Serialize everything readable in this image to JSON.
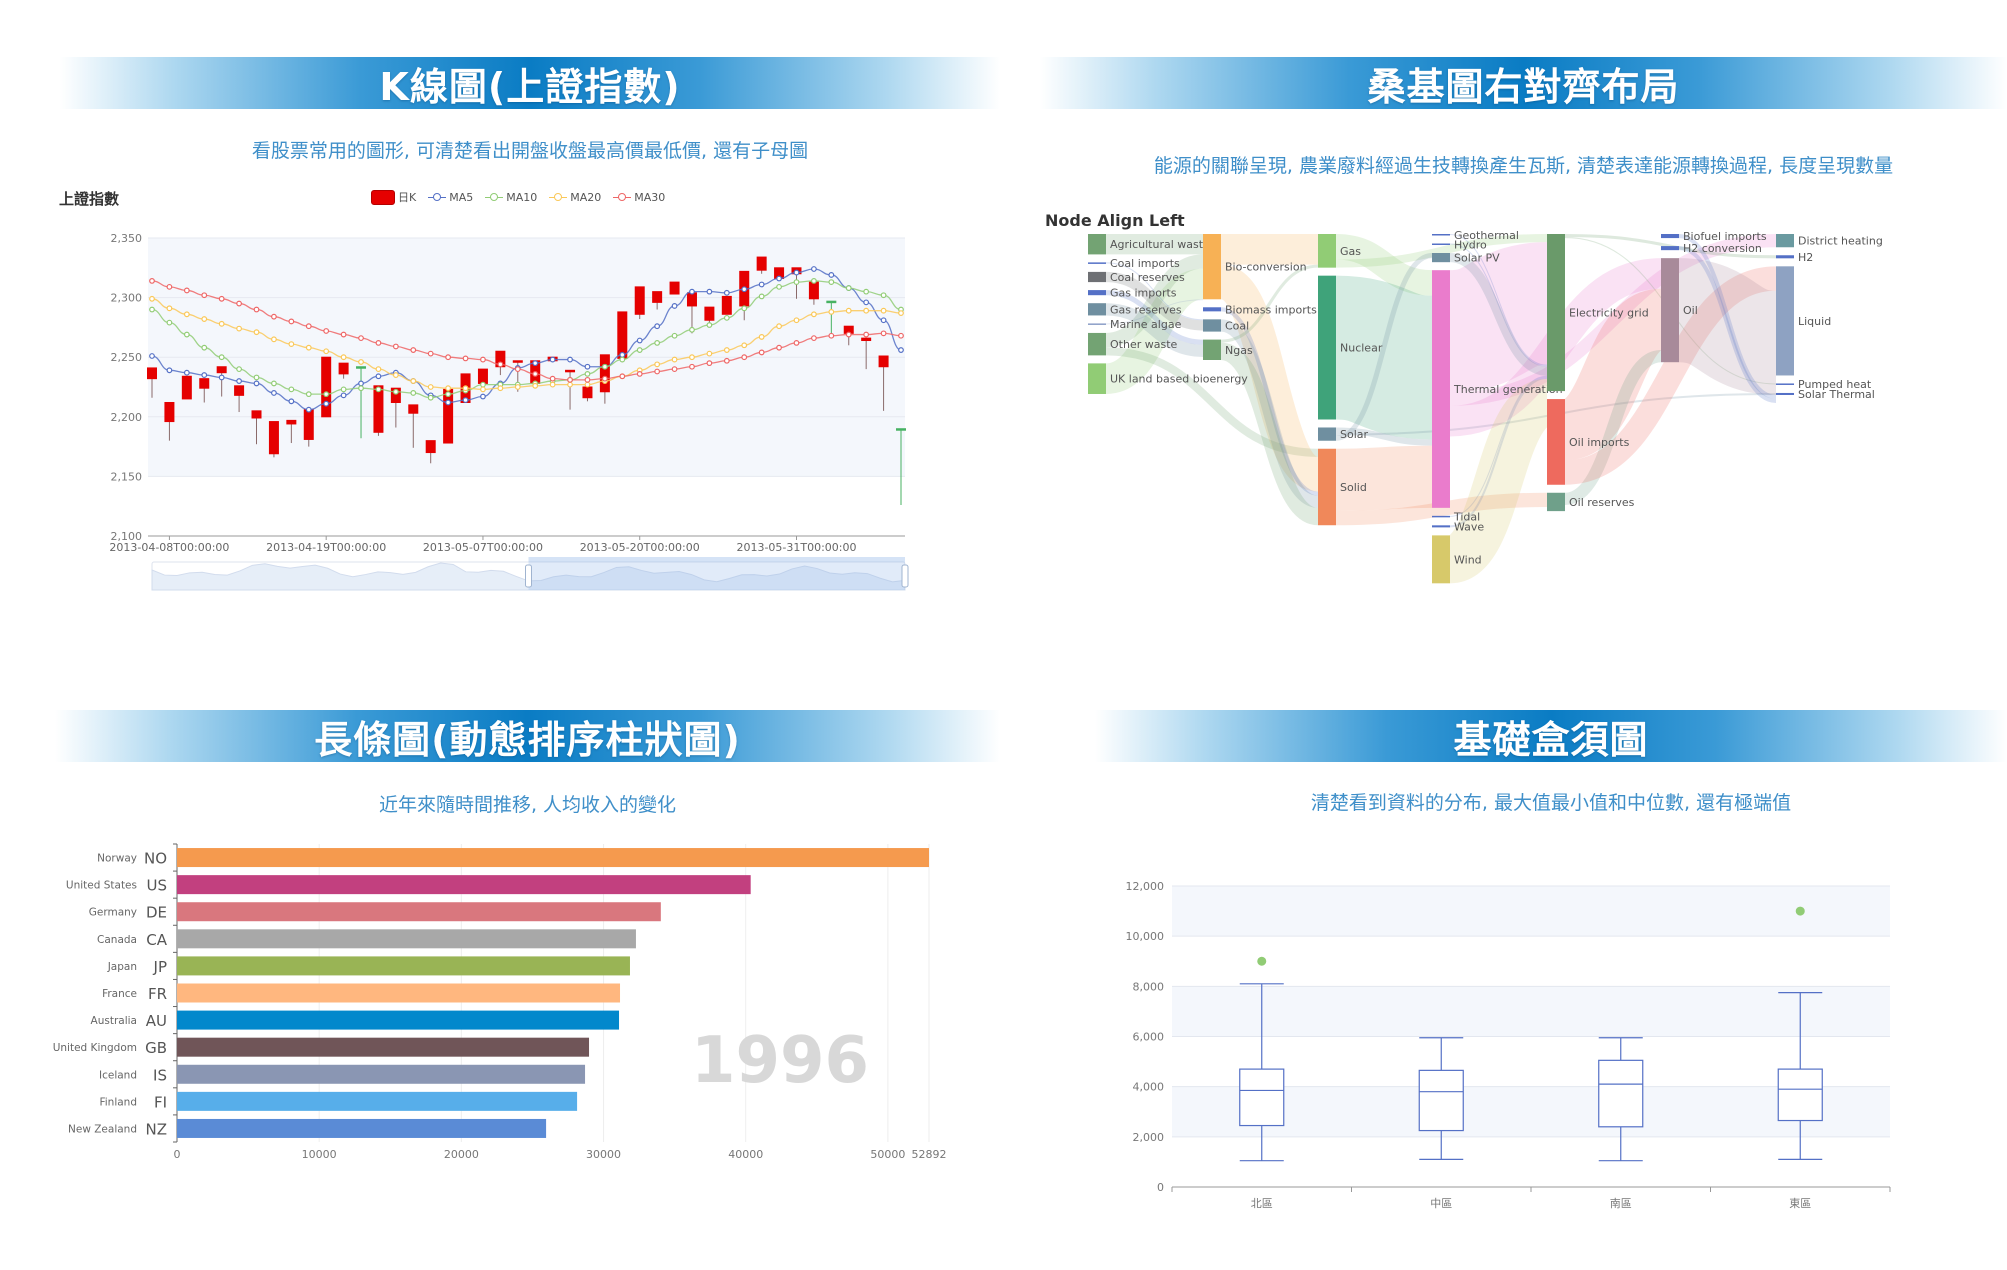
{
  "panels": {
    "kline": {
      "banner": "K線圖(上證指數)",
      "subtitle": "看股票常用的圖形, 可清楚看出開盤收盤最高價最低價, 還有子母圖"
    },
    "sankey": {
      "banner": "桑基圖右對齊布局",
      "subtitle": "能源的關聯呈現, 農業廢料經過生技轉換產生瓦斯, 清楚表達能源轉換過程, 長度呈現數量"
    },
    "bar": {
      "banner": "長條圖(動態排序柱狀圖)",
      "subtitle": "近年來隨時間推移, 人均收入的變化"
    },
    "boxplot": {
      "banner": "基礎盒須圖",
      "subtitle": "清楚看到資料的分布, 最大值最小值和中位數, 還有極端值"
    }
  },
  "chart_data": [
    {
      "type": "candlestick",
      "title": "上證指數",
      "legend": [
        "日K",
        "MA5",
        "MA10",
        "MA20",
        "MA30"
      ],
      "legend_position": "top-center",
      "colors": {
        "up": "#e50000",
        "doji": "#47b262",
        "MA5": "#5470c6",
        "MA10": "#91cc75",
        "MA20": "#fac858",
        "MA30": "#ee6666"
      },
      "ylim": [
        2100,
        2350
      ],
      "yticks": [
        2100,
        2150,
        2200,
        2250,
        2300,
        2350
      ],
      "ytick_labels": [
        "2,100",
        "2,150",
        "2,200",
        "2,250",
        "2,300",
        "2,350"
      ],
      "xtick_labels": [
        "2013-04-08T00:00:00",
        "2013-04-19T00:00:00",
        "2013-05-07T00:00:00",
        "2013-05-20T00:00:00",
        "2013-05-31T00:00:00"
      ],
      "xtick_indices": [
        1,
        10,
        19,
        28,
        37
      ],
      "datazoom_range_percent": [
        50,
        100
      ],
      "ohlc": [
        [
          2232,
          2241,
          2216,
          2241
        ],
        [
          2196,
          2212,
          2180,
          2212
        ],
        [
          2215,
          2234,
          2215,
          2234
        ],
        [
          2224,
          2232,
          2212,
          2232
        ],
        [
          2237,
          2242,
          2217,
          2242
        ],
        [
          2218,
          2226,
          2204,
          2226
        ],
        [
          2199,
          2205,
          2177,
          2205
        ],
        [
          2169,
          2196,
          2166,
          2196
        ],
        [
          2194,
          2197,
          2178,
          2197
        ],
        [
          2181,
          2206,
          2175,
          2206
        ],
        [
          2200,
          2250,
          2200,
          2250
        ],
        [
          2236,
          2245,
          2232,
          2245
        ],
        [
          2242,
          2242,
          2182,
          2242
        ],
        [
          2187,
          2226,
          2184,
          2226
        ],
        [
          2212,
          2224,
          2191,
          2224
        ],
        [
          2203,
          2210,
          2174,
          2210
        ],
        [
          2170,
          2180,
          2161,
          2180
        ],
        [
          2178,
          2223,
          2178,
          2223
        ],
        [
          2212,
          2236,
          2212,
          2236
        ],
        [
          2228,
          2240,
          2228,
          2240
        ],
        [
          2242,
          2255,
          2235,
          2255
        ],
        [
          2246,
          2247,
          2221,
          2247
        ],
        [
          2228,
          2247,
          2228,
          2247
        ],
        [
          2247,
          2250,
          2247,
          2250
        ],
        [
          2238,
          2239,
          2206,
          2239
        ],
        [
          2216,
          2225,
          2213,
          2225
        ],
        [
          2221,
          2252,
          2211,
          2252
        ],
        [
          2249,
          2288,
          2249,
          2288
        ],
        [
          2286,
          2309,
          2282,
          2309
        ],
        [
          2296,
          2305,
          2290,
          2305
        ],
        [
          2303,
          2313,
          2303,
          2313
        ],
        [
          2293,
          2304,
          2270,
          2304
        ],
        [
          2281,
          2292,
          2275,
          2292
        ],
        [
          2286,
          2301,
          2286,
          2301
        ],
        [
          2293,
          2322,
          2281,
          2322
        ],
        [
          2323,
          2334,
          2320,
          2334
        ],
        [
          2316,
          2325,
          2316,
          2325
        ],
        [
          2320,
          2325,
          2299,
          2325
        ],
        [
          2299,
          2313,
          2294,
          2313
        ],
        [
          2297,
          2297,
          2270,
          2297
        ],
        [
          2270,
          2276,
          2260,
          2276
        ],
        [
          2264,
          2266,
          2240,
          2266
        ],
        [
          2242,
          2251,
          2205,
          2251
        ],
        [
          2190,
          2190,
          2126,
          2190
        ]
      ],
      "ma": {
        "MA5": [
          2251,
          2239,
          2237,
          2235,
          2233,
          2230,
          2228,
          2220,
          2213,
          2206,
          2211,
          2218,
          2228,
          2234,
          2237,
          2230,
          2218,
          2212,
          2214,
          2217,
          2228,
          2241,
          2245,
          2248,
          2248,
          2242,
          2242,
          2252,
          2264,
          2276,
          2293,
          2305,
          2305,
          2304,
          2307,
          2311,
          2316,
          2321,
          2324,
          2319,
          2308,
          2296,
          2281,
          2256
        ],
        "MA10": [
          2290,
          2279,
          2269,
          2258,
          2250,
          2240,
          2233,
          2228,
          2223,
          2219,
          2219,
          2223,
          2224,
          2223,
          2221,
          2220,
          2216,
          2219,
          2222,
          2227,
          2227,
          2227,
          2228,
          2230,
          2231,
          2236,
          2242,
          2248,
          2256,
          2262,
          2268,
          2273,
          2277,
          2283,
          2291,
          2301,
          2309,
          2313,
          2314,
          2313,
          2308,
          2305,
          2302,
          2290
        ],
        "MA20": [
          2299,
          2291,
          2286,
          2282,
          2278,
          2274,
          2271,
          2265,
          2261,
          2258,
          2255,
          2250,
          2246,
          2240,
          2235,
          2230,
          2225,
          2224,
          2224,
          2223,
          2224,
          2225,
          2226,
          2227,
          2227,
          2227,
          2230,
          2234,
          2239,
          2244,
          2248,
          2250,
          2253,
          2256,
          2260,
          2267,
          2276,
          2281,
          2286,
          2288,
          2289,
          2289,
          2289,
          2287
        ],
        "MA30": [
          2314,
          2309,
          2306,
          2302,
          2299,
          2295,
          2290,
          2284,
          2280,
          2276,
          2272,
          2269,
          2266,
          2262,
          2259,
          2256,
          2253,
          2250,
          2249,
          2248,
          2244,
          2240,
          2236,
          2232,
          2231,
          2231,
          2232,
          2234,
          2236,
          2238,
          2240,
          2242,
          2245,
          2247,
          2250,
          2254,
          2258,
          2262,
          2266,
          2268,
          2269,
          2269,
          2270,
          2268
        ]
      }
    },
    {
      "type": "sankey",
      "title": "Node Align Left",
      "node_align": "left",
      "columns": [
        [
          {
            "name": "Agricultural waste",
            "value": 20,
            "color": "#73a373"
          },
          {
            "name": "Coal imports",
            "value": 1,
            "color": "#5470c6"
          },
          {
            "name": "Coal reserves",
            "value": 10,
            "color": "#6e7074"
          },
          {
            "name": "Gas imports",
            "value": 5,
            "color": "#5470c6"
          },
          {
            "name": "Gas reserves",
            "value": 12,
            "color": "#6f8fa0"
          },
          {
            "name": "Marine algae",
            "value": 1,
            "color": "#8c9ec7"
          },
          {
            "name": "Other waste",
            "value": 22,
            "color": "#73a373"
          },
          {
            "name": "UK land based bioenergy",
            "value": 30,
            "color": "#91cc75"
          }
        ],
        [
          {
            "name": "Bio-conversion",
            "value": 64,
            "color": "#f7b155"
          },
          {
            "name": "Biomass imports",
            "value": 4,
            "color": "#5470c6"
          },
          {
            "name": "Coal",
            "value": 12,
            "color": "#6f8fa0"
          },
          {
            "name": "Ngas",
            "value": 20,
            "color": "#73a373"
          }
        ],
        [
          {
            "name": "Gas",
            "value": 33,
            "color": "#91cc75"
          },
          {
            "name": "Nuclear",
            "value": 141,
            "color": "#3fa37a"
          },
          {
            "name": "Solar",
            "value": 13,
            "color": "#6f8fa0"
          },
          {
            "name": "Solid",
            "value": 75,
            "color": "#f0885a"
          }
        ],
        [
          {
            "name": "Geothermal",
            "value": 1,
            "color": "#5470c6"
          },
          {
            "name": "Hydro",
            "value": 1,
            "color": "#5470c6"
          },
          {
            "name": "Solar PV",
            "value": 9,
            "color": "#6f8fa0"
          },
          {
            "name": "Thermal generation",
            "value": 233,
            "color": "#ea7ccc"
          },
          {
            "name": "Tidal",
            "value": 1,
            "color": "#5470c6"
          },
          {
            "name": "Wave",
            "value": 2,
            "color": "#5470c6"
          },
          {
            "name": "Wind",
            "value": 47,
            "color": "#d7c96a"
          }
        ],
        [
          {
            "name": "Electricity grid",
            "value": 154,
            "color": "#6a9a6a"
          },
          {
            "name": "Oil imports",
            "value": 84,
            "color": "#ee6a5e"
          },
          {
            "name": "Oil reserves",
            "value": 18,
            "color": "#6fa08a"
          }
        ],
        [
          {
            "name": "Biofuel imports",
            "value": 4,
            "color": "#5470c6"
          },
          {
            "name": "H2 conversion",
            "value": 4,
            "color": "#5470c6"
          },
          {
            "name": "Oil",
            "value": 102,
            "color": "#a88a9a"
          }
        ],
        [
          {
            "name": "District heating",
            "value": 13,
            "color": "#6a9aa0"
          },
          {
            "name": "H2",
            "value": 3,
            "color": "#5470c6"
          },
          {
            "name": "Liquid",
            "value": 107,
            "color": "#8ea2c2"
          },
          {
            "name": "Pumped heat",
            "value": 1,
            "color": "#5470c6"
          },
          {
            "name": "Solar Thermal",
            "value": 2,
            "color": "#5470c6"
          }
        ]
      ],
      "links": [
        {
          "source": "Agricultural waste",
          "target": "Bio-conversion",
          "value": 20
        },
        {
          "source": "Other waste",
          "target": "Bio-conversion",
          "value": 14
        },
        {
          "source": "UK land based bioenergy",
          "target": "Bio-conversion",
          "value": 30
        },
        {
          "source": "Marine algae",
          "target": "Bio-conversion",
          "value": 1
        },
        {
          "source": "Coal imports",
          "target": "Coal",
          "value": 1
        },
        {
          "source": "Coal reserves",
          "target": "Coal",
          "value": 10
        },
        {
          "source": "Gas imports",
          "target": "Ngas",
          "value": 5
        },
        {
          "source": "Gas reserves",
          "target": "Ngas",
          "value": 12
        },
        {
          "source": "Other waste",
          "target": "Solid",
          "value": 8
        },
        {
          "source": "Bio-conversion",
          "target": "Gas",
          "value": 30
        },
        {
          "source": "Bio-conversion",
          "target": "Solid",
          "value": 34
        },
        {
          "source": "Biomass imports",
          "target": "Solid",
          "value": 4
        },
        {
          "source": "Coal",
          "target": "Solid",
          "value": 12
        },
        {
          "source": "Ngas",
          "target": "Gas",
          "value": 3
        },
        {
          "source": "Ngas",
          "target": "Solid",
          "value": 17
        },
        {
          "source": "Gas",
          "target": "Thermal generation",
          "value": 25
        },
        {
          "source": "Gas",
          "target": "Electricity grid",
          "value": 8
        },
        {
          "source": "Nuclear",
          "target": "Thermal generation",
          "value": 141
        },
        {
          "source": "Solar",
          "target": "Thermal generation",
          "value": 6
        },
        {
          "source": "Solar",
          "target": "Solar Thermal",
          "value": 2
        },
        {
          "source": "Solar",
          "target": "Solar PV",
          "value": 5
        },
        {
          "source": "Solid",
          "target": "Thermal generation",
          "value": 61
        },
        {
          "source": "Solid",
          "target": "Oil reserves",
          "value": 14
        },
        {
          "source": "Thermal generation",
          "target": "Electricity grid",
          "value": 120
        },
        {
          "source": "Thermal generation",
          "target": "District heating",
          "value": 13
        },
        {
          "source": "Thermal generation",
          "target": "Oil",
          "value": 30
        },
        {
          "source": "Geothermal",
          "target": "Electricity grid",
          "value": 1
        },
        {
          "source": "Hydro",
          "target": "Electricity grid",
          "value": 1
        },
        {
          "source": "Solar PV",
          "target": "Electricity grid",
          "value": 9
        },
        {
          "source": "Tidal",
          "target": "Electricity grid",
          "value": 1
        },
        {
          "source": "Wave",
          "target": "Electricity grid",
          "value": 2
        },
        {
          "source": "Wind",
          "target": "Electricity grid",
          "value": 47
        },
        {
          "source": "Electricity grid",
          "target": "H2",
          "value": 3
        },
        {
          "source": "Electricity grid",
          "target": "Pumped heat",
          "value": 1
        },
        {
          "source": "Oil imports",
          "target": "Oil",
          "value": 60
        },
        {
          "source": "Oil reserves",
          "target": "Oil",
          "value": 12
        },
        {
          "source": "Oil imports",
          "target": "Liquid",
          "value": 24
        },
        {
          "source": "Oil",
          "target": "Liquid",
          "value": 102
        },
        {
          "source": "Biofuel imports",
          "target": "Liquid",
          "value": 4
        },
        {
          "source": "H2 conversion",
          "target": "Liquid",
          "value": 4
        }
      ]
    },
    {
      "type": "bar",
      "orientation": "horizontal",
      "title": "",
      "year_label": "1996",
      "categories": [
        {
          "code": "NO",
          "name": "Norway",
          "color": "#f59a4e"
        },
        {
          "code": "US",
          "name": "United States",
          "color": "#c2407f"
        },
        {
          "code": "DE",
          "name": "Germany",
          "color": "#d9777e"
        },
        {
          "code": "CA",
          "name": "Canada",
          "color": "#a8a8a8"
        },
        {
          "code": "JP",
          "name": "Japan",
          "color": "#99b455"
        },
        {
          "code": "FR",
          "name": "France",
          "color": "#ffb77f"
        },
        {
          "code": "AU",
          "name": "Australia",
          "color": "#0288cc"
        },
        {
          "code": "GB",
          "name": "United Kingdom",
          "color": "#705558"
        },
        {
          "code": "IS",
          "name": "Iceland",
          "color": "#8a96b3"
        },
        {
          "code": "FI",
          "name": "Finland",
          "color": "#57aeea"
        },
        {
          "code": "NZ",
          "name": "New Zealand",
          "color": "#5a8bd6"
        }
      ],
      "values": [
        52892,
        40350,
        34030,
        32280,
        31860,
        31160,
        31090,
        28980,
        28700,
        28140,
        25960
      ],
      "xlim": [
        0,
        52892
      ],
      "xticks": [
        0,
        10000,
        20000,
        30000,
        40000,
        50000,
        52892
      ],
      "xtick_labels": [
        "0",
        "10000",
        "20000",
        "30000",
        "40000",
        "50000",
        "52892"
      ],
      "grid": true
    },
    {
      "type": "boxplot",
      "title": "",
      "categories": [
        "北區",
        "中區",
        "南區",
        "東區"
      ],
      "boxes": [
        {
          "min": 1050,
          "q1": 2450,
          "median": 3850,
          "q3": 4700,
          "max": 8100
        },
        {
          "min": 1100,
          "q1": 2250,
          "median": 3800,
          "q3": 4650,
          "max": 5950
        },
        {
          "min": 1050,
          "q1": 2400,
          "median": 4100,
          "q3": 5050,
          "max": 5950
        },
        {
          "min": 1100,
          "q1": 2650,
          "median": 3900,
          "q3": 4700,
          "max": 7750
        }
      ],
      "outliers": [
        {
          "category": "北區",
          "value": 9000
        },
        {
          "category": "東區",
          "value": 11000
        }
      ],
      "ylim": [
        0,
        12000
      ],
      "yticks": [
        0,
        2000,
        4000,
        6000,
        8000,
        10000,
        12000
      ],
      "ytick_labels": [
        "0",
        "2,000",
        "4,000",
        "6,000",
        "8,000",
        "10,000",
        "12,000"
      ],
      "colors": {
        "box": "#5470c6",
        "outlier": "#91cc75"
      }
    }
  ]
}
